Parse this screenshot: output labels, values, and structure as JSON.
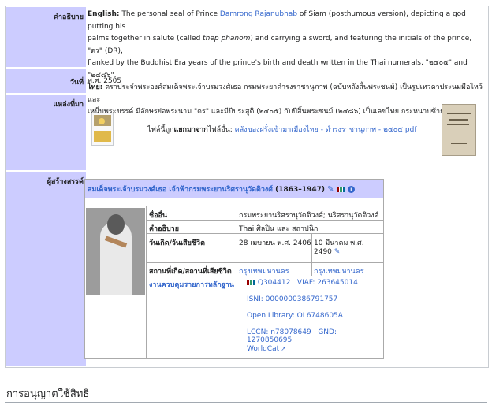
{
  "rows": {
    "description_label": "คำอธิบาย",
    "date_label": "วันที่",
    "source_label": "แหล่งที่มา",
    "author_label": "ผู้สร้างสรรค์"
  },
  "description": {
    "en_prefix": "English:",
    "en_1": " The personal seal of Prince ",
    "en_link": "Damrong Rajanubhab",
    "en_2": " of Siam (posthumous version), depicting a god putting his",
    "en_3": "palms together in salute (called ",
    "en_italic": "thep phanom",
    "en_4": ") and carrying a sword, and featuring the initials of the prince, \"ดร\" (DR),",
    "en_5": "flanked by the Buddhist Era years of the prince's birth and death written in the Thai numerals, \"๒๔๐๕\" and \"๒๔๘๖\".",
    "th_prefix": "ไทย:",
    "th_1": " ตราประจำพระองค์สมเด็จพระเจ้าบรมวงศ์เธอ กรมพระยาดำรงราชานุภาพ (ฉบับหลังสิ้นพระชนม์) เป็นรูปเทวดาประนมมือไหว้และ",
    "th_2": "เหน็บพระขรรค์ มีอักษรย่อพระนาม \"ดร\" และมีปีประสูติ (๒๔๐๕) กับปีสิ้นพระชนม์ (๒๔๘๖) เป็นเลขไทย กระหนาบซ้ายขวา"
  },
  "date": "พ.ศ. 2505",
  "source": {
    "prefix": "ไฟล์นี้ถูก",
    "bold": "แยกมาจาก",
    "mid": "ไฟล์อื่น: ",
    "link": "คลังของฝรั่งเข้ามาเมืองไทย - ดำรงราชานุภาพ - ๒๔๐๕.pdf"
  },
  "author": {
    "name": "สมเด็จพระเจ้าบรมวงศ์เธอ เจ้าฟ้ากรมพระยานริศรานุวัดติวงศ์",
    "years": "(1863–1947)",
    "other_names_label": "ชื่ออื่น",
    "other_names_value": "กรมพระยานริศรานุวัดติวงศ์; นริศรานุวัดติวงศ์",
    "description_label": "คำอธิบาย",
    "description_value": "Thai ศิลปิน และ สถาปนิก",
    "birth_death_label": "วันเกิด/วันเสียชีวิต",
    "birth_value": "28 เมษายน พ.ศ. 2406",
    "death_value": "10 มีนาคม พ.ศ. 2490",
    "place_label": "สถานที่เกิด/สถานที่เสียชีวิต",
    "birth_place": "กรุงเทพมหานคร",
    "death_place": "กรุงเทพมหานคร",
    "authority_label": "งานควบคุมรายการหลักฐาน",
    "qid": "Q304412",
    "viaf": "VIAF: 263645014",
    "isni": "ISNI: 0000000386791757",
    "openlibrary": "Open Library: OL6748605A",
    "lccn": "LCCN: n78078649",
    "gnd": "GND: 1270850695",
    "worldcat": "WorldCat"
  },
  "section_title": "การอนุญาตใช้สิทธิ"
}
